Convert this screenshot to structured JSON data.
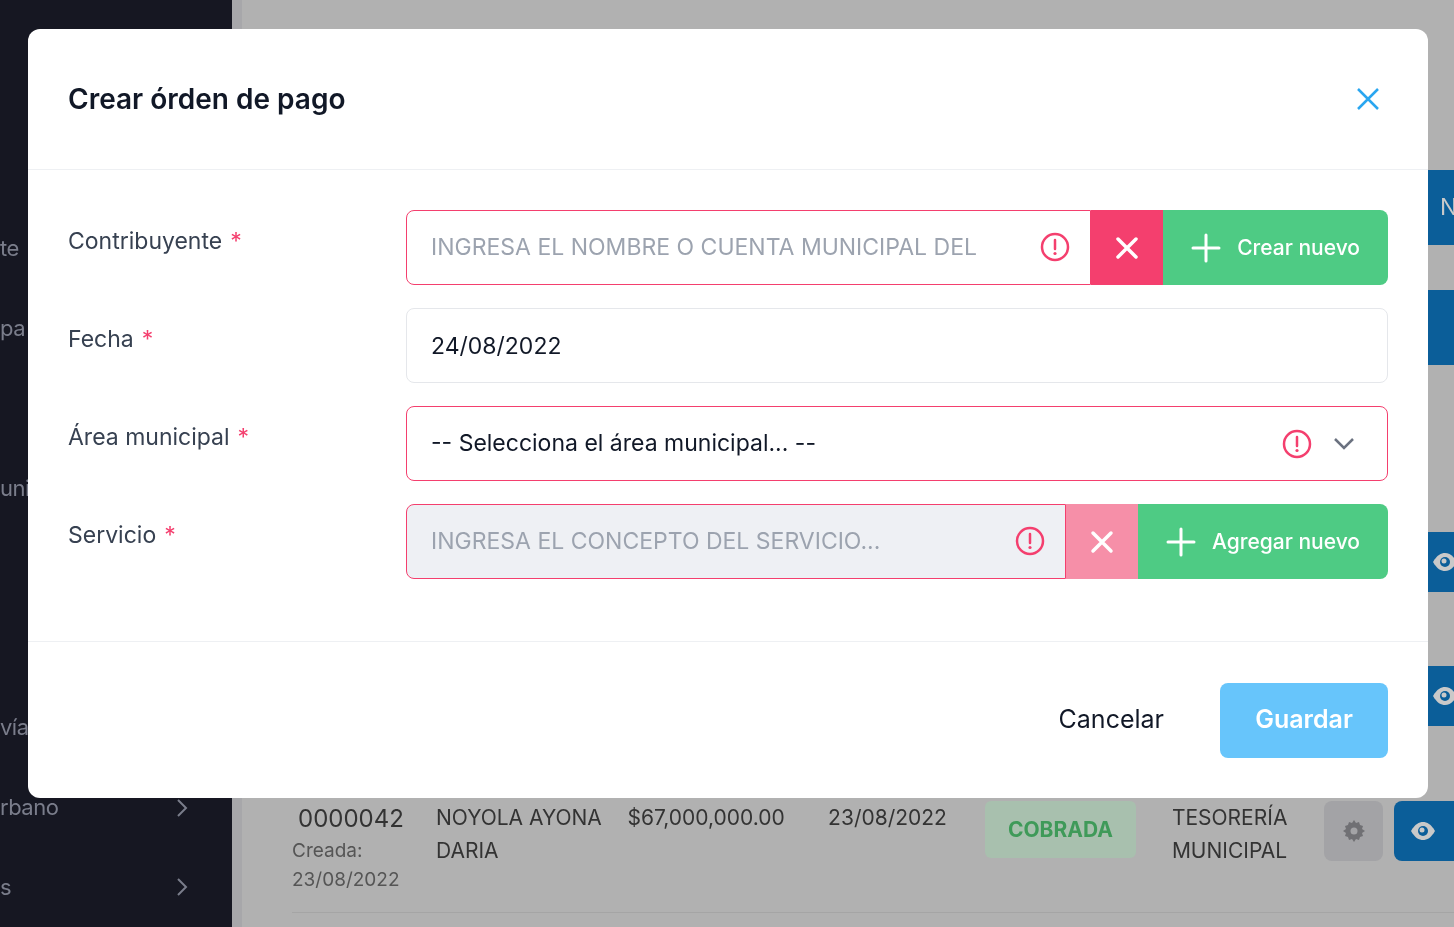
{
  "sidebar": {
    "items": [
      {
        "label": "te",
        "chevron": false
      },
      {
        "label": "pa",
        "chevron": false
      },
      {
        "label": "uni",
        "chevron": false
      },
      {
        "label": "vía",
        "chevron": false
      },
      {
        "label": "rbano",
        "chevron": true
      },
      {
        "label": "s",
        "chevron": true
      }
    ]
  },
  "background": {
    "edge_button_label": "N",
    "table_row": {
      "number": "0000042",
      "created_label": "Creada:",
      "created_date": "23/08/2022",
      "name": "NOYOLA AYONA DARIA",
      "amount": "$67,000,000.00",
      "date": "23/08/2022",
      "status": "COBRADA",
      "area": "TESORERÍA MUNICIPAL"
    }
  },
  "modal": {
    "title": "Crear órden de pago",
    "fields": [
      {
        "kind": "search",
        "label": "Contribuyente",
        "required_mark": "*",
        "placeholder": "INGRESA EL NOMBRE O CUENTA MUNICIPAL DEL",
        "invalid": true,
        "disabled": false,
        "add_label": "Crear nuevo"
      },
      {
        "kind": "text",
        "label": "Fecha",
        "required_mark": "*",
        "value": "24/08/2022",
        "invalid": false
      },
      {
        "kind": "select",
        "label": "Área municipal",
        "required_mark": "*",
        "value": "-- Selecciona el área municipal... --",
        "invalid": true
      },
      {
        "kind": "search",
        "label": "Servicio",
        "required_mark": "*",
        "placeholder": "INGRESA EL CONCEPTO DEL SERVICIO...",
        "invalid": true,
        "disabled": true,
        "add_label": "Agregar nuevo"
      }
    ],
    "cancel": "Cancelar",
    "save": {
      "label": "Guardar",
      "disabled": true
    }
  }
}
